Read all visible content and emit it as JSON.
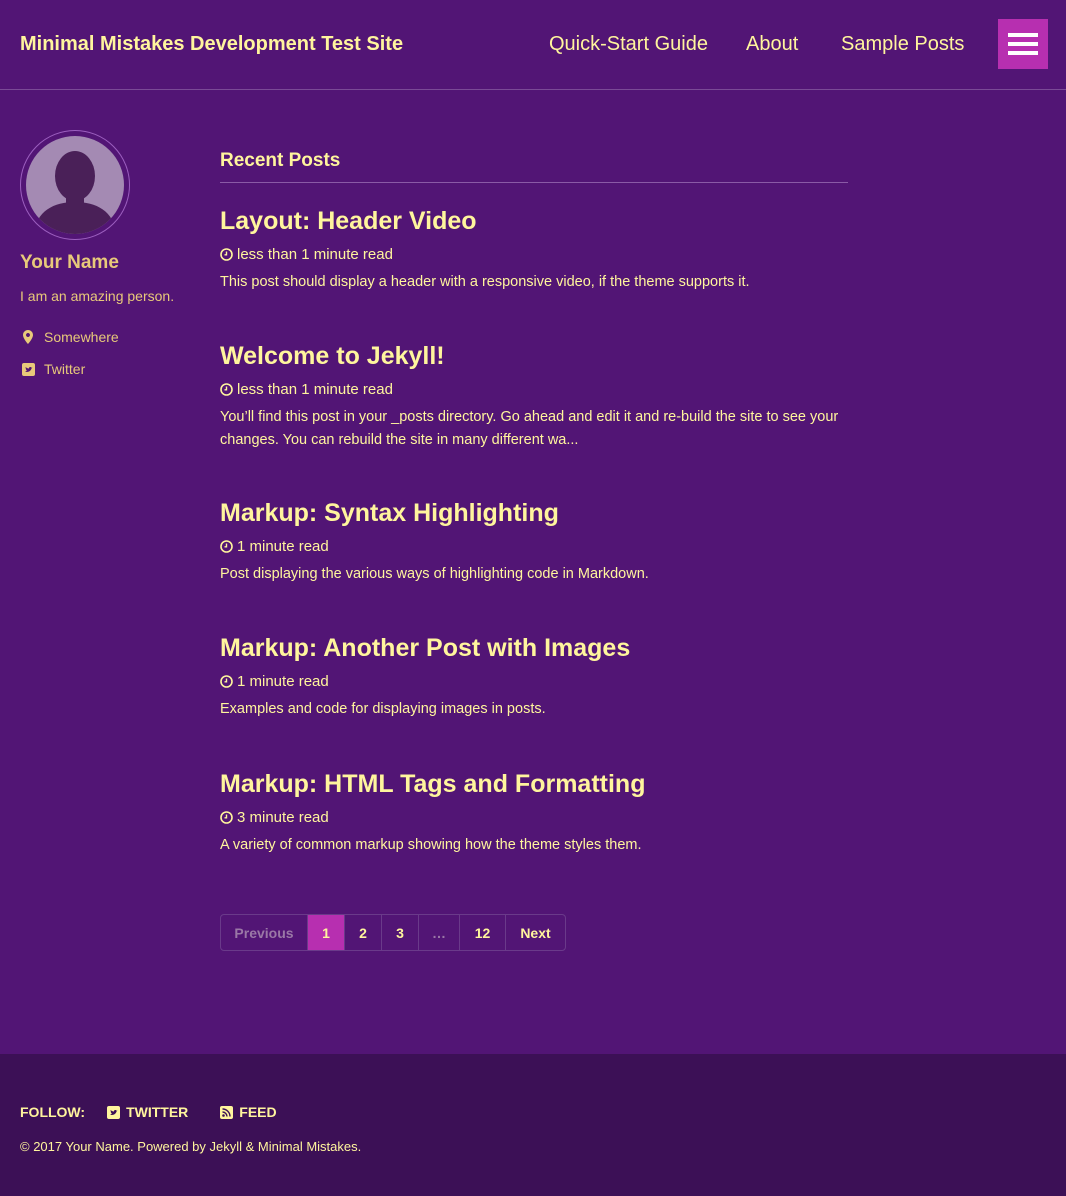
{
  "header": {
    "site_title": "Minimal Mistakes Development Test Site",
    "nav": [
      "Quick-Start Guide",
      "About",
      "Sample Posts"
    ],
    "menu_icon": "hamburger-icon"
  },
  "sidebar": {
    "author_name": "Your Name",
    "author_bio": "I am an amazing person.",
    "links": [
      {
        "label": "Somewhere",
        "icon": "map-marker-icon"
      },
      {
        "label": "Twitter",
        "icon": "twitter-square-icon"
      }
    ]
  },
  "main": {
    "archive_title": "Recent Posts",
    "posts": [
      {
        "title": "Layout: Header Video",
        "read_time": "less than 1 minute read",
        "excerpt": "This post should display a header with a responsive video, if the theme supports it."
      },
      {
        "title": "Welcome to Jekyll!",
        "read_time": "less than 1 minute read",
        "excerpt": "You’ll find this post in your _posts directory. Go ahead and edit it and re-build the site to see your changes. You can rebuild the site in many different wa..."
      },
      {
        "title": "Markup: Syntax Highlighting",
        "read_time": "1 minute read",
        "excerpt": "Post displaying the various ways of highlighting code in Markdown."
      },
      {
        "title": "Markup: Another Post with Images",
        "read_time": "1 minute read",
        "excerpt": "Examples and code for displaying images in posts."
      },
      {
        "title": "Markup: HTML Tags and Formatting",
        "read_time": "3 minute read",
        "excerpt": "A variety of common markup showing how the theme styles them."
      }
    ]
  },
  "pagination": {
    "previous": "Previous",
    "pages": [
      "1",
      "2",
      "3",
      "…",
      "12"
    ],
    "current": "1",
    "next": "Next"
  },
  "footer": {
    "follow_label": "FOLLOW:",
    "follow_links": [
      {
        "label": "TWITTER",
        "icon": "twitter-square-icon"
      },
      {
        "label": "FEED",
        "icon": "rss-icon"
      }
    ],
    "copyright": "© 2017 Your Name. Powered by Jekyll & Minimal Mistakes."
  },
  "colors": {
    "background": "#521575",
    "text": "#fff59d",
    "accent": "#b72fb0",
    "footer_bg": "#3c1056"
  }
}
